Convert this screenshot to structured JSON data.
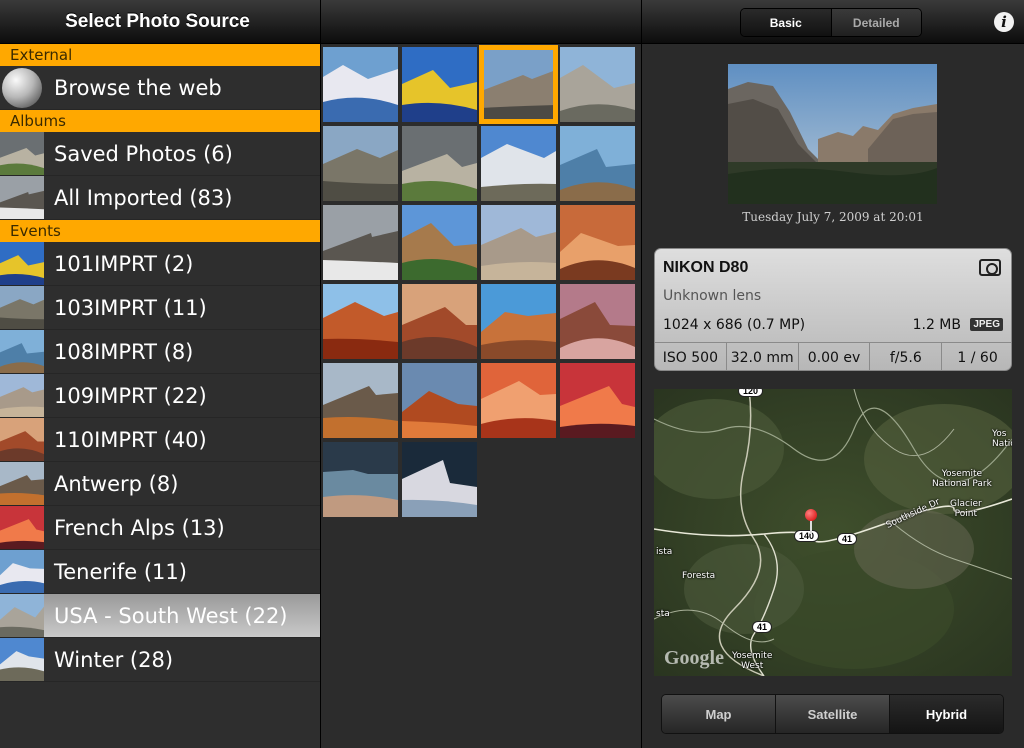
{
  "sidebar": {
    "title": "Select Photo Source",
    "sections": {
      "external": "External",
      "albums": "Albums",
      "events": "Events"
    },
    "external_items": [
      {
        "label": "Browse the web",
        "icon": "globe-icon"
      }
    ],
    "album_items": [
      {
        "label": "Saved Photos (6)"
      },
      {
        "label": "All Imported (83)"
      }
    ],
    "event_items": [
      {
        "label": "101IMPRT (2)"
      },
      {
        "label": "103IMPRT (11)"
      },
      {
        "label": "108IMPRT (8)"
      },
      {
        "label": "109IMPRT (22)"
      },
      {
        "label": "110IMPRT (40)"
      },
      {
        "label": "Antwerp (8)"
      },
      {
        "label": "French Alps (13)"
      },
      {
        "label": "Tenerife (11)"
      },
      {
        "label": "USA - South West (22)",
        "selected": true
      },
      {
        "label": "Winter (28)"
      }
    ]
  },
  "grid": {
    "selected_index": 2,
    "photo_count": 22
  },
  "detail": {
    "tabs": {
      "basic": "Basic",
      "detailed": "Detailed",
      "active": "Basic"
    },
    "info_icon": "i",
    "date": "Tuesday July 7, 2009 at 20:01",
    "camera": {
      "model": "NIKON D80",
      "lens": "Unknown lens",
      "resolution": "1024 x 686 (0.7 MP)",
      "size": "1.2 MB",
      "format": "JPEG",
      "iso": "ISO 500",
      "focal": "32.0 mm",
      "ev": "0.00 ev",
      "aperture": "f/5.6",
      "shutter": "1 / 60"
    },
    "map": {
      "labels": {
        "yosemite_park": "Yosemite\nNational Park",
        "glacier_point": "Glacier\nPoint",
        "yosemite_west": "Yosemite\nWest",
        "foresta": "Foresta",
        "yos_nationa": "Yos\nNationa",
        "southside": "Southside Dr",
        "ista": "ista",
        "sta": "sta"
      },
      "shields": {
        "r120": "120",
        "r140": "140",
        "r41a": "41",
        "r41b": "41"
      },
      "logo": "Google"
    },
    "map_modes": {
      "map": "Map",
      "satellite": "Satellite",
      "hybrid": "Hybrid",
      "active": "Hybrid"
    }
  },
  "colors": {
    "accent": "#ffa800",
    "selected_row": "#b5b5b5"
  }
}
